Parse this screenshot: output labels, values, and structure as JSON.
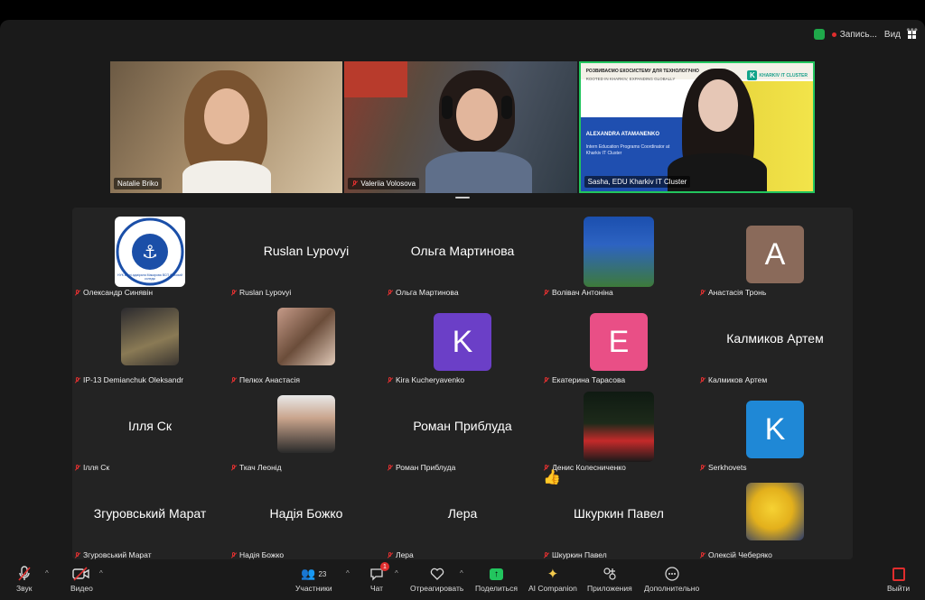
{
  "topbar": {
    "recording_label": "Запись...",
    "view_label": "Вид"
  },
  "speakers": [
    {
      "name": "Natalie Briko"
    },
    {
      "name": "Valeriia Volosova"
    },
    {
      "name": "Sasha, EDU Kharkiv IT Cluster",
      "slide": {
        "line1": "РОЗВИВАЄМО ЕКОСИСТЕМУ ДЛЯ ТЕХНОЛОГІЧНО",
        "line2": "ROOTED IN KHARKIV, EXPANDING GLOBALLY",
        "person": "ALEXANDRA ATAMANENKO",
        "role": "Intern Education Programs Coordinator at Kharkiv IT Cluster",
        "logo_letter": "K",
        "logo_text": "KHARKIV IT CLUSTER"
      }
    }
  ],
  "participants": [
    {
      "name": "Олександр Синявін",
      "kind": "image",
      "icon": "college-emblem",
      "emblem_text": "НУК імені адмірала Макарова ВСП Фаховий коледж"
    },
    {
      "name": "Ruslan Lypovyi",
      "kind": "text",
      "display": "Ruslan Lypovyi"
    },
    {
      "name": "Ольга Мартинова",
      "kind": "text",
      "display": "Ольга Мартинова"
    },
    {
      "name": "Волівач Антоніна",
      "kind": "image",
      "icon": "portrait-woman"
    },
    {
      "name": "Анастасія Тронь",
      "kind": "letter",
      "letter": "A",
      "color": "#8a6a5a"
    },
    {
      "name": "IP-13 Demianchuk Oleksandr",
      "kind": "image",
      "icon": "anime-avatar"
    },
    {
      "name": "Пелюх Анастасія",
      "kind": "image",
      "icon": "collage-avatar"
    },
    {
      "name": "Kira Kucheryavenko",
      "kind": "letter",
      "letter": "K",
      "color": "#6b3fc7"
    },
    {
      "name": "Екатерина Тарасова",
      "kind": "letter",
      "letter": "E",
      "color": "#e94f86"
    },
    {
      "name": "Калмиков Артем",
      "kind": "text",
      "display": "Калмиков Артем"
    },
    {
      "name": "Ілля Ск",
      "kind": "text",
      "display": "Ілля Ск"
    },
    {
      "name": "Ткач Леонід",
      "kind": "image",
      "icon": "portrait-man"
    },
    {
      "name": "Роман Приблуда",
      "kind": "text",
      "display": "Роман Приблуда"
    },
    {
      "name": "Денис Колесниченко",
      "kind": "image",
      "icon": "portrait-man-red"
    },
    {
      "name": "Serkhovets",
      "kind": "letter",
      "letter": "K",
      "color": "#1f88d6"
    },
    {
      "name": "Згуровський Марат",
      "kind": "text",
      "display": "Згуровський Марат"
    },
    {
      "name": "Надія Божко",
      "kind": "text",
      "display": "Надія Божко"
    },
    {
      "name": "Лера",
      "kind": "text",
      "display": "Лера"
    },
    {
      "name": "Шкуркин Павел",
      "kind": "text",
      "display": "Шкуркин Павел",
      "reaction": "👍"
    },
    {
      "name": "Олексій Чеберяко",
      "kind": "image",
      "icon": "pikachu-avatar"
    }
  ],
  "toolbar": {
    "audio": "Звук",
    "video": "Видео",
    "participants": "Участники",
    "participants_count": "23",
    "chat": "Чат",
    "chat_badge": "1",
    "react": "Отреагировать",
    "share": "Поделиться",
    "companion": "AI Companion",
    "apps": "Приложения",
    "more": "Дополнительно",
    "leave": "Выйти"
  },
  "colors": {
    "active_speaker_border": "#22c55e",
    "mute": "#e03030",
    "leave": "#e02d2d"
  }
}
